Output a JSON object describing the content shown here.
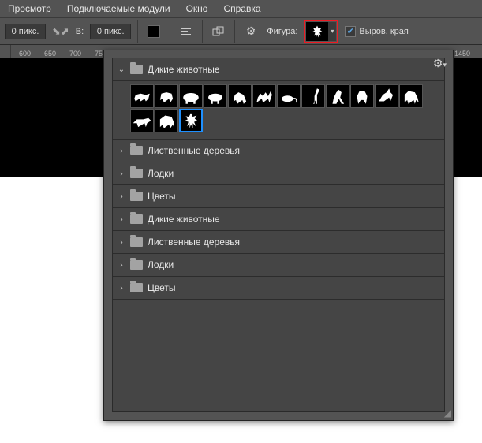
{
  "menu": {
    "items": [
      "Просмотр",
      "Подключаемые модули",
      "Окно",
      "Справка"
    ]
  },
  "optbar": {
    "w_value": "0 пикс.",
    "w_label": "В:",
    "h_value": "0 пикс.",
    "shape_label": "Фигура:",
    "align_label": "Выров. края",
    "align_checked": true
  },
  "ruler": {
    "left": [
      "600",
      "650",
      "700",
      "75"
    ],
    "right": [
      "1450"
    ]
  },
  "panel": {
    "groups": [
      {
        "name": "Дикие животные",
        "expanded": true,
        "shapes": [
          "rhino",
          "bear",
          "hippo",
          "hippo2",
          "lion",
          "camel",
          "rat",
          "giraffe",
          "kangaroo",
          "gorilla",
          "antelope",
          "mammoth",
          "panther",
          "elephant",
          "deer"
        ],
        "selected_index": 14
      },
      {
        "name": "Лиственные деревья",
        "expanded": false
      },
      {
        "name": "Лодки",
        "expanded": false
      },
      {
        "name": "Цветы",
        "expanded": false
      },
      {
        "name": "Дикие животные",
        "expanded": false
      },
      {
        "name": "Лиственные деревья",
        "expanded": false
      },
      {
        "name": "Лодки",
        "expanded": false
      },
      {
        "name": "Цветы",
        "expanded": false
      }
    ]
  }
}
